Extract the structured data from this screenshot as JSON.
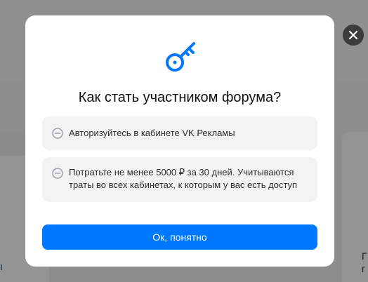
{
  "modal": {
    "title": "Как стать участником форума?",
    "icon": "key-icon",
    "items": [
      {
        "icon": "minus-circle-icon",
        "text": "Авторизуйтесь в кабинете VK Рекламы"
      },
      {
        "icon": "minus-circle-icon",
        "text": "Потратьте не менее 5000 ₽ за 30 дней. Учитываются траты во всех кабинетах, к которым у вас есть доступ"
      }
    ],
    "ok_button_label": "Ок, понятно",
    "close_icon": "close-icon"
  },
  "background": {
    "left_glyph": "ı",
    "right_glyph": "Г\nг"
  },
  "colors": {
    "accent": "#0077ff",
    "item_bg": "#f2f3f5",
    "close_bg": "#3b3c3e"
  }
}
